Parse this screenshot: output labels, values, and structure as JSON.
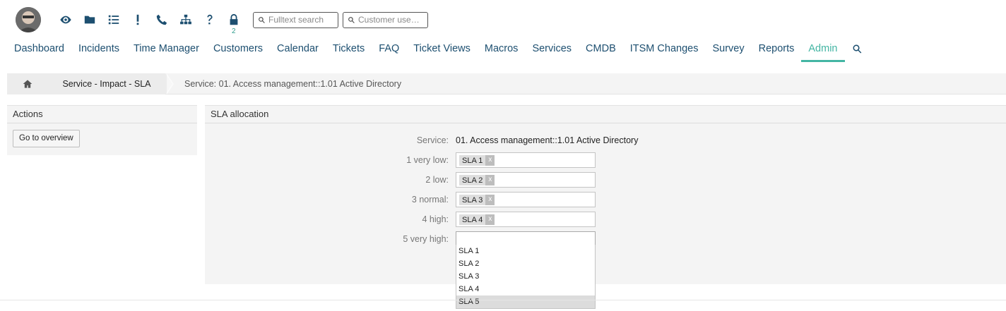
{
  "toolbar": {
    "avatar": "user-avatar",
    "icons": [
      "eye-icon",
      "folder-icon",
      "list-icon",
      "exclamation-icon",
      "phone-icon",
      "sitemap-icon",
      "question-icon",
      "lock-icon"
    ],
    "lock_badge": "2",
    "search_placeholder": "Fulltext search",
    "customer_placeholder": "Customer use…"
  },
  "nav": {
    "items": [
      "Dashboard",
      "Incidents",
      "Time Manager",
      "Customers",
      "Calendar",
      "Tickets",
      "FAQ",
      "Ticket Views",
      "Macros",
      "Services",
      "CMDB",
      "ITSM Changes",
      "Survey",
      "Reports",
      "Admin"
    ],
    "active": "Admin"
  },
  "breadcrumb": {
    "item1": "Service - Impact - SLA",
    "item2": "Service: 01. Access management::1.01 Active Directory"
  },
  "actions": {
    "title": "Actions",
    "overview_button": "Go to overview"
  },
  "sla": {
    "title": "SLA allocation",
    "service_label": "Service:",
    "service_value": "01. Access management::1.01 Active Directory",
    "rows": [
      {
        "label": "1 very low:",
        "tag": "SLA 1"
      },
      {
        "label": "2 low:",
        "tag": "SLA 2"
      },
      {
        "label": "3 normal:",
        "tag": "SLA 3"
      },
      {
        "label": "4 high:",
        "tag": "SLA 4"
      },
      {
        "label": "5 very high:",
        "tag": ""
      }
    ],
    "tag_remove": "x",
    "dropdown_options": [
      "SLA 1",
      "SLA 2",
      "SLA 3",
      "SLA 4",
      "SLA 5"
    ],
    "dropdown_highlighted": "SLA 5"
  },
  "colors": {
    "nav_text": "#1d4f70",
    "active": "#43b5a3",
    "panel_bg": "#f4f4f4"
  }
}
